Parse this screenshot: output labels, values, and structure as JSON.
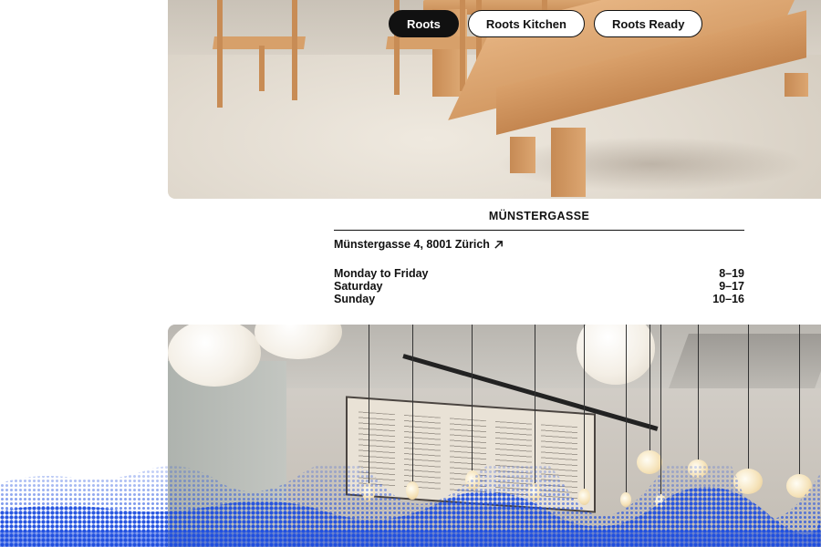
{
  "tabs": [
    {
      "label": "Roots",
      "active": true
    },
    {
      "label": "Roots Kitchen",
      "active": false
    },
    {
      "label": "Roots Ready",
      "active": false
    }
  ],
  "location": {
    "name": "MÜNSTERGASSE",
    "address": "Münstergasse 4, 8001 Zürich",
    "address_icon": "external-arrow-icon",
    "hours": [
      {
        "days": "Monday to Friday",
        "time": "8–19"
      },
      {
        "days": "Saturday",
        "time": "9–17"
      },
      {
        "days": "Sunday",
        "time": "10–16"
      }
    ]
  },
  "colors": {
    "accent_blue": "#1f4fe0",
    "text": "#111111",
    "active_tab_bg": "#111111",
    "wood": "#d49b65"
  }
}
